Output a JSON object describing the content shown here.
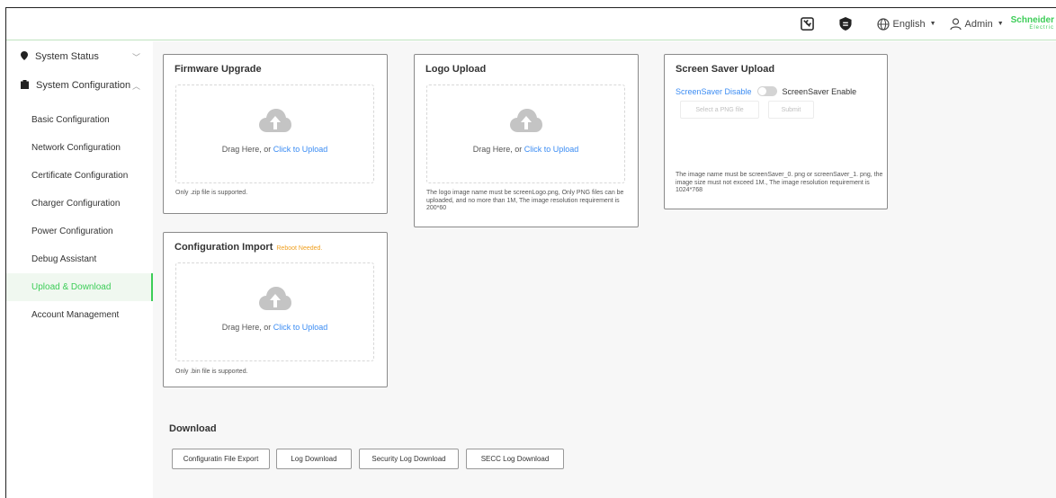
{
  "header": {
    "language": "English",
    "user": "Admin",
    "brand_line1": "Schneider",
    "brand_line2": "Electric",
    "brand_color": "#3dcd58"
  },
  "sidebar": {
    "system_status": "System Status",
    "system_configuration": "System Configuration",
    "items": [
      {
        "label": "Basic Configuration"
      },
      {
        "label": "Network Configuration"
      },
      {
        "label": "Certificate Configuration"
      },
      {
        "label": "Charger Configuration"
      },
      {
        "label": "Power Configuration"
      },
      {
        "label": "Debug Assistant"
      },
      {
        "label": "Upload & Download",
        "active": true
      },
      {
        "label": "Account Management"
      }
    ]
  },
  "firmware": {
    "title": "Firmware Upgrade",
    "drag_text": "Drag Here, or ",
    "link_text": "Click to Upload",
    "note": "Only .zip file is supported."
  },
  "logo": {
    "title": "Logo Upload",
    "drag_text": "Drag Here, or ",
    "link_text": "Click to Upload",
    "note": "The logo image name must be screenLogo.png, Only PNG files can be uploaded, and no more than 1M, The image resolution requirement is 200*60"
  },
  "screensaver": {
    "title": "Screen Saver Upload",
    "disable_label": "ScreenSaver Disable",
    "enable_label": "ScreenSaver Enable",
    "select_button": "Select a PNG file",
    "submit_button": "Submit",
    "note": "The image name must be screenSaver_0. png or screenSaver_1. png, the image size must not exceed 1M., The image resolution requirement is 1024*768"
  },
  "config_import": {
    "title": "Configuration Import",
    "badge": "Reboot Needed.",
    "drag_text": "Drag Here, or ",
    "link_text": "Click to Upload",
    "note": "Only .bin file is supported."
  },
  "download": {
    "title": "Download",
    "buttons": [
      "Configuratin File Export",
      "Log Download",
      "Security Log Download",
      "SECC Log Download"
    ]
  },
  "colors": {
    "accent": "#3dcd58",
    "link": "#3b8cf3",
    "warning": "#f0a020"
  }
}
